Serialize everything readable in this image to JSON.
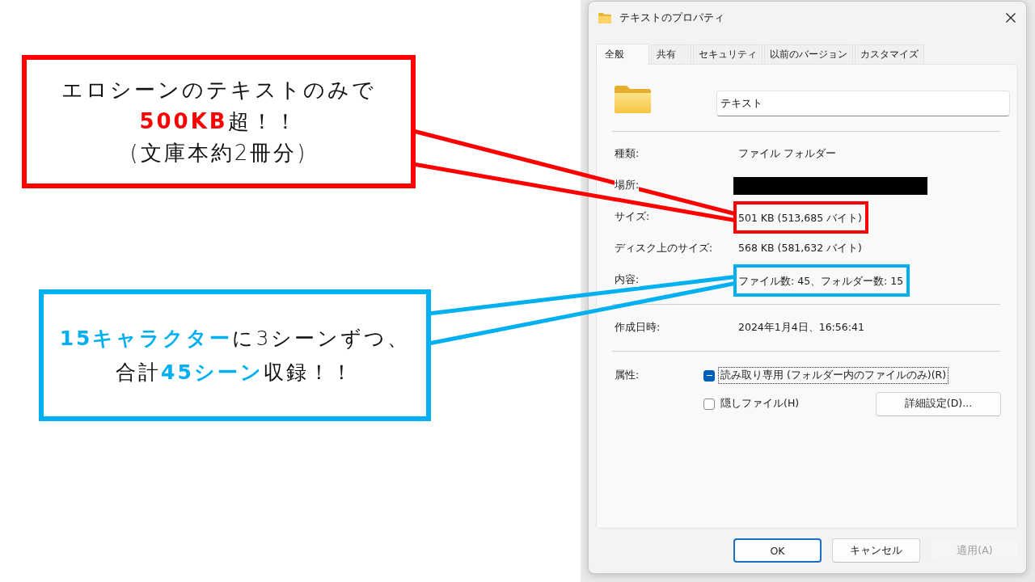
{
  "callouts": [
    {
      "color": "#ff0000",
      "lines": [
        "エロシーンのテキストのみで",
        "**500KB**超！！",
        "(文庫本約2冊分)"
      ]
    },
    {
      "color": "#00b0f0",
      "lines": [
        "**15キャラクター**に3シーンずつ、",
        "合計**45シーン**収録！！"
      ]
    }
  ],
  "window": {
    "title": "テキストのプロパティ"
  },
  "tabs": [
    {
      "label": "全般",
      "selected": true
    },
    {
      "label": "共有",
      "selected": false
    },
    {
      "label": "セキュリティ",
      "selected": false
    },
    {
      "label": "以前のバージョン",
      "selected": false
    },
    {
      "label": "カスタマイズ",
      "selected": false
    }
  ],
  "general": {
    "name_field": {
      "value": "テキスト"
    },
    "rows": [
      {
        "kind": "text",
        "label": "種類:",
        "value": "ファイル フォルダー",
        "highlighted": false
      },
      {
        "kind": "redacted",
        "label": "場所:",
        "highlighted": false
      },
      {
        "kind": "text",
        "label": "サイズ:",
        "value": "501 KB (513,685 バイト)",
        "highlighted": true
      },
      {
        "kind": "text",
        "label": "ディスク上のサイズ:",
        "value": "568 KB (581,632 バイト)",
        "highlighted": false
      },
      {
        "kind": "text",
        "label": "内容:",
        "value": "ファイル数: 45、フォルダー数: 15",
        "highlighted": true
      }
    ],
    "created": {
      "label": "作成日時:",
      "value": "2024年1月4日、16:56:41"
    },
    "attributes": {
      "label": "属性:",
      "options": [
        {
          "label": "読み取り専用 (フォルダー内のファイルのみ)(R)",
          "checked": true,
          "indeterminate": true,
          "focused": true
        },
        {
          "label": "隠しファイル(H)",
          "checked": false,
          "indeterminate": false,
          "focused": false
        }
      ],
      "advanced_button": "詳細設定(D)..."
    }
  },
  "buttons": [
    {
      "label": "OK",
      "default": true,
      "disabled": false
    },
    {
      "label": "キャンセル",
      "default": false,
      "disabled": false
    },
    {
      "label": "適用(A)",
      "default": false,
      "disabled": true
    }
  ]
}
